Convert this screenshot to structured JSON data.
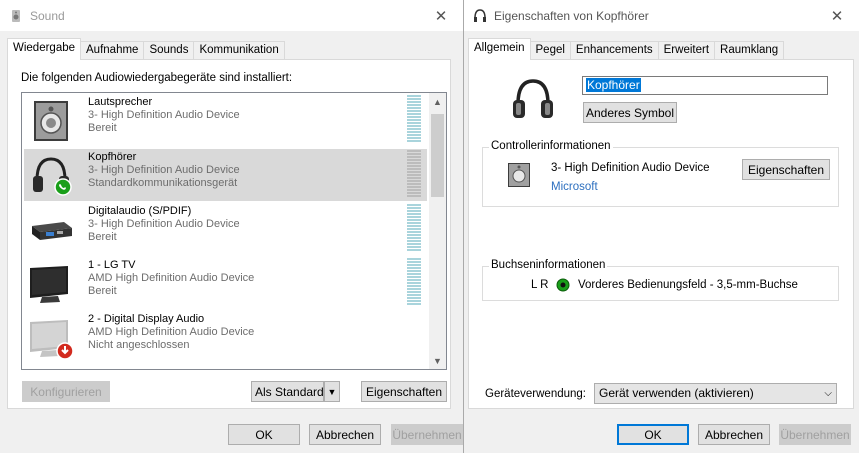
{
  "sound": {
    "title": "Sound",
    "tabs": [
      "Wiedergabe",
      "Aufnahme",
      "Sounds",
      "Kommunikation"
    ],
    "intro": "Die folgenden Audiowiedergabegeräte sind installiert:",
    "devices": [
      {
        "name": "Lautsprecher",
        "line2": "3- High Definition Audio Device",
        "line3": "Bereit",
        "icon": "speaker-icon"
      },
      {
        "name": "Kopfhörer",
        "line2": "3- High Definition Audio Device",
        "line3": "Standardkommunikationsgerät",
        "icon": "headphones-icon",
        "selected": true
      },
      {
        "name": "Digitalaudio (S/PDIF)",
        "line2": "3- High Definition Audio Device",
        "line3": "Bereit",
        "icon": "digital-audio-icon"
      },
      {
        "name": "1 - LG TV",
        "line2": "AMD High Definition Audio Device",
        "line3": "Bereit",
        "icon": "monitor-icon"
      },
      {
        "name": "2 - Digital Display Audio",
        "line2": "AMD High Definition Audio Device",
        "line3": "Nicht angeschlossen",
        "icon": "monitor-disconnected-icon"
      }
    ],
    "buttons": {
      "configure": "Konfigurieren",
      "set_default": "Als Standard",
      "properties": "Eigenschaften",
      "ok": "OK",
      "cancel": "Abbrechen",
      "apply": "Übernehmen"
    }
  },
  "props": {
    "title": "Eigenschaften von Kopfhörer",
    "tabs": [
      "Allgemein",
      "Pegel",
      "Enhancements",
      "Erweitert",
      "Raumklang"
    ],
    "name_value": "Kopfhörer",
    "change_icon": "Anderes Symbol",
    "controller": {
      "legend": "Controllerinformationen",
      "device": "3- High Definition Audio Device",
      "vendor": "Microsoft",
      "properties": "Eigenschaften"
    },
    "jack": {
      "legend": "Buchseninformationen",
      "channels": "L R",
      "description": "Vorderes Bedienungsfeld - 3,5-mm-Buchse",
      "jack_color": "#1a9f1a"
    },
    "usage_label": "Geräteverwendung:",
    "usage_value": "Gerät verwenden (aktivieren)",
    "buttons": {
      "ok": "OK",
      "cancel": "Abbrechen",
      "apply": "Übernehmen"
    }
  },
  "colors": {
    "accent": "#0078d7",
    "selection": "#d9d9d9",
    "link": "#2c6fbf",
    "comm_badge": "#1a9f1a",
    "disconnected_badge": "#d22a1e"
  }
}
